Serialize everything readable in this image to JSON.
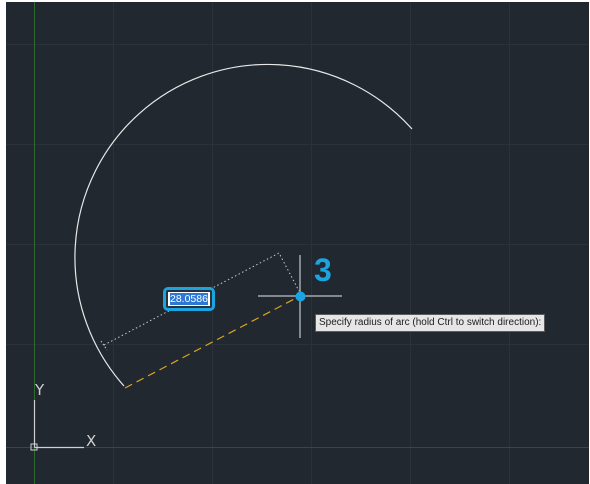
{
  "viewport": {
    "background": "#212830",
    "x_axis_color": "#7a2a2a",
    "y_axis_color": "#2f6a2f"
  },
  "dimension_input": {
    "value": "28.0586",
    "accent_color": "#1aa4e0"
  },
  "tooltip": {
    "text": "Specify radius of arc (hold Ctrl to switch direction):"
  },
  "step_marker": {
    "number": "3",
    "color": "#1aa4e0"
  },
  "ucs_icon": {
    "x_label": "X",
    "y_label": "Y"
  },
  "icons": {
    "crosshair": "crosshair-cursor-icon",
    "ucs": "ucs-icon"
  }
}
